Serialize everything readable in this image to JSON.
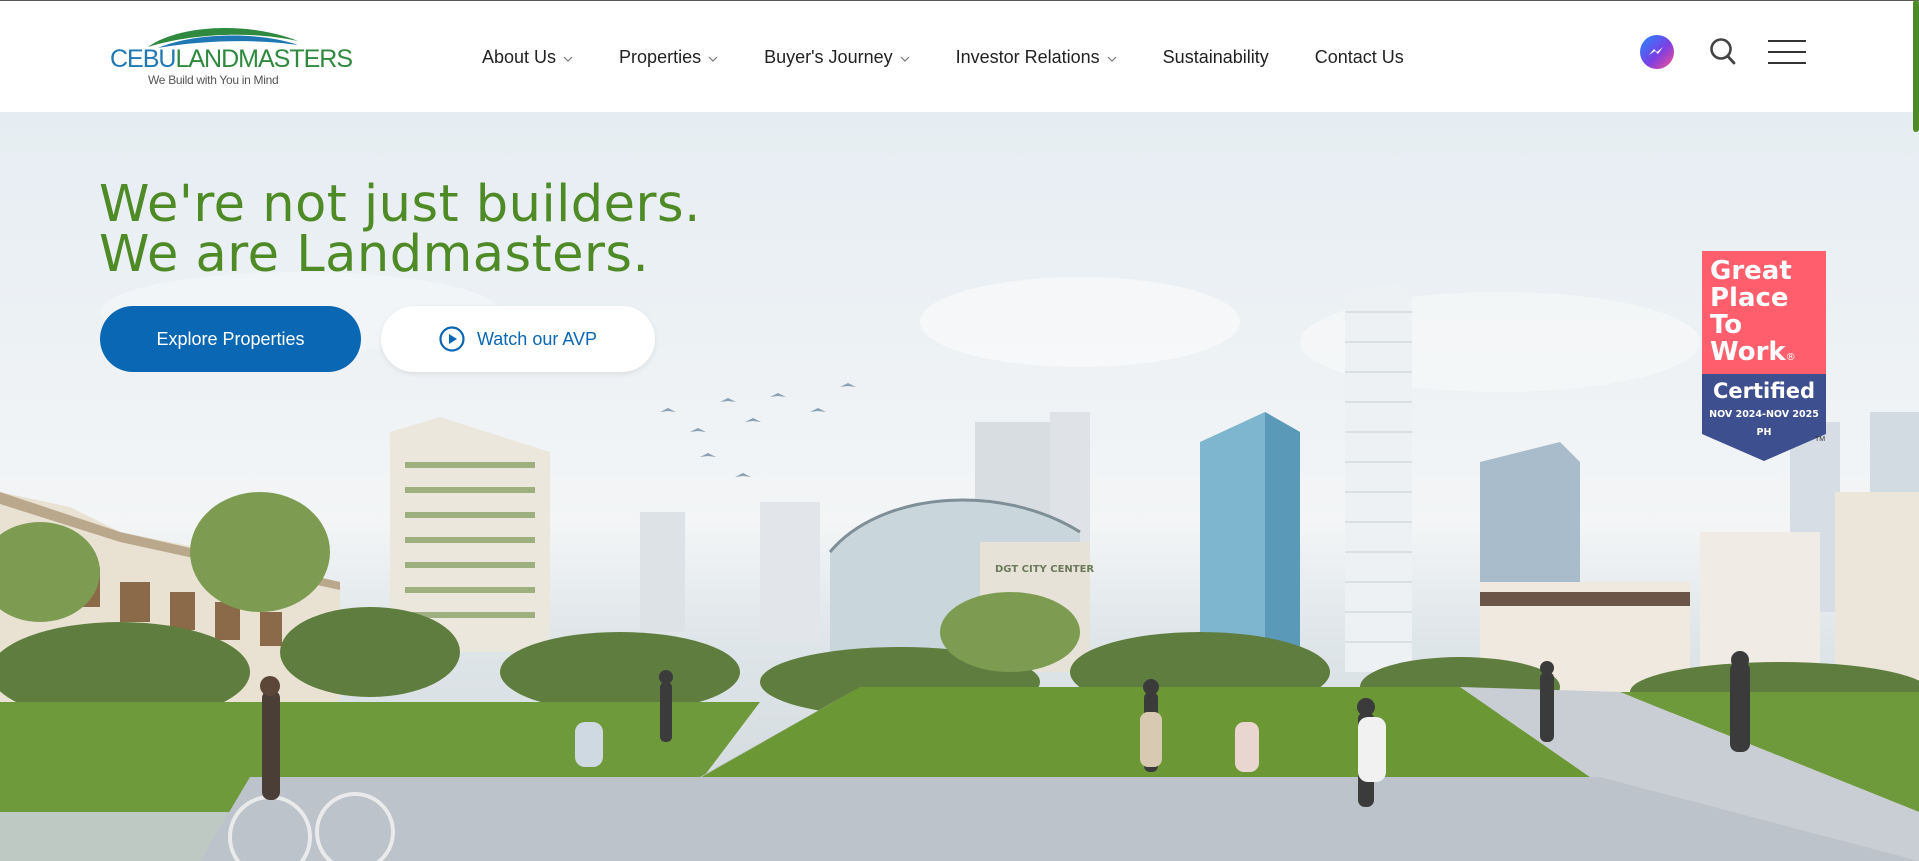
{
  "brand": {
    "logo_part1": "CEBU",
    "logo_part2": "LANDMASTERS",
    "tagline": "We Build with You in Mind"
  },
  "nav": {
    "items": [
      {
        "label": "About Us",
        "has_dropdown": true
      },
      {
        "label": "Properties",
        "has_dropdown": true
      },
      {
        "label": "Buyer's Journey",
        "has_dropdown": true
      },
      {
        "label": "Investor Relations",
        "has_dropdown": true
      },
      {
        "label": "Sustainability",
        "has_dropdown": false
      },
      {
        "label": "Contact Us",
        "has_dropdown": false
      }
    ],
    "icons": [
      "messenger-icon",
      "search-icon",
      "hamburger-menu-icon"
    ]
  },
  "hero": {
    "title_line1": "We're not just builders.",
    "title_line2": "We are Landmasters.",
    "primary_cta": "Explore Properties",
    "secondary_cta": "Watch our AVP",
    "building_sign": "DGT CITY CENTER"
  },
  "badge": {
    "line1": "Great",
    "line2": "Place",
    "line3": "To",
    "line4": "Work",
    "registered": "®",
    "certified": "Certified",
    "dates": "NOV 2024-NOV 2025",
    "country": "PH",
    "trademark": "TM"
  },
  "colors": {
    "brand_green": "#4e8a25",
    "brand_blue": "#0a67b3",
    "badge_pink": "#ff5f6d",
    "badge_navy": "#3e4f8f"
  }
}
